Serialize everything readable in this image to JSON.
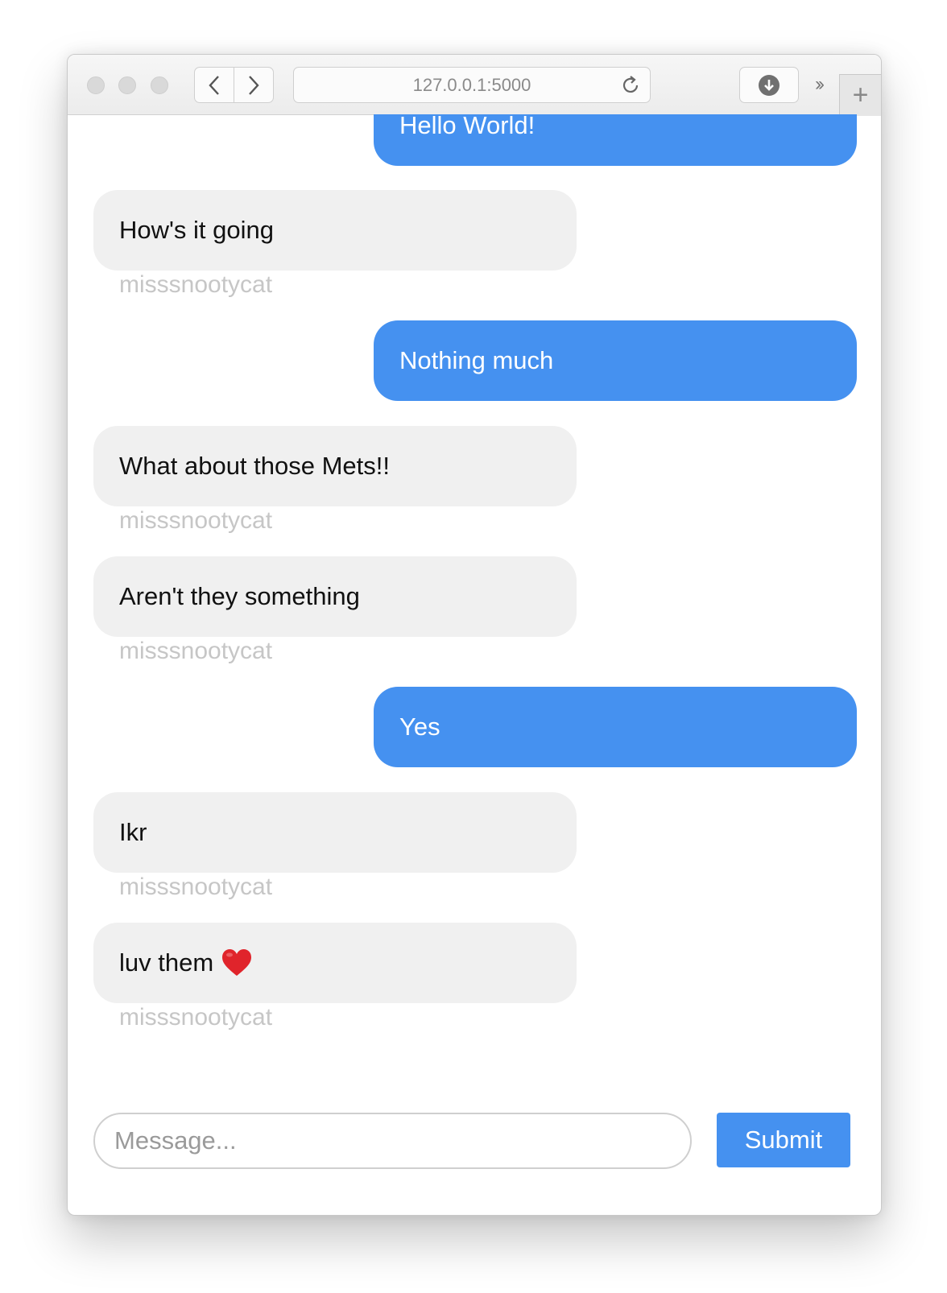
{
  "browser": {
    "url": "127.0.0.1:5000"
  },
  "messages": [
    {
      "direction": "sent",
      "text": "Hello World!"
    },
    {
      "direction": "received",
      "text": "How's it going",
      "sender": "misssnootycat"
    },
    {
      "direction": "sent",
      "text": "Nothing much"
    },
    {
      "direction": "received",
      "text": "What about those Mets!!",
      "sender": "misssnootycat"
    },
    {
      "direction": "received",
      "text": "Aren't they something",
      "sender": "misssnootycat"
    },
    {
      "direction": "sent",
      "text": "Yes"
    },
    {
      "direction": "received",
      "text": "Ikr",
      "sender": "misssnootycat"
    },
    {
      "direction": "received",
      "text": "luv them",
      "emoji": "heart-emoji",
      "sender": "misssnootycat"
    }
  ],
  "composer": {
    "placeholder": "Message...",
    "submit_label": "Submit"
  },
  "colors": {
    "sent_bubble": "#4591f0",
    "received_bubble": "#f0f0f0",
    "sender_label": "#c6c6c6",
    "submit_button": "#4591f0"
  }
}
